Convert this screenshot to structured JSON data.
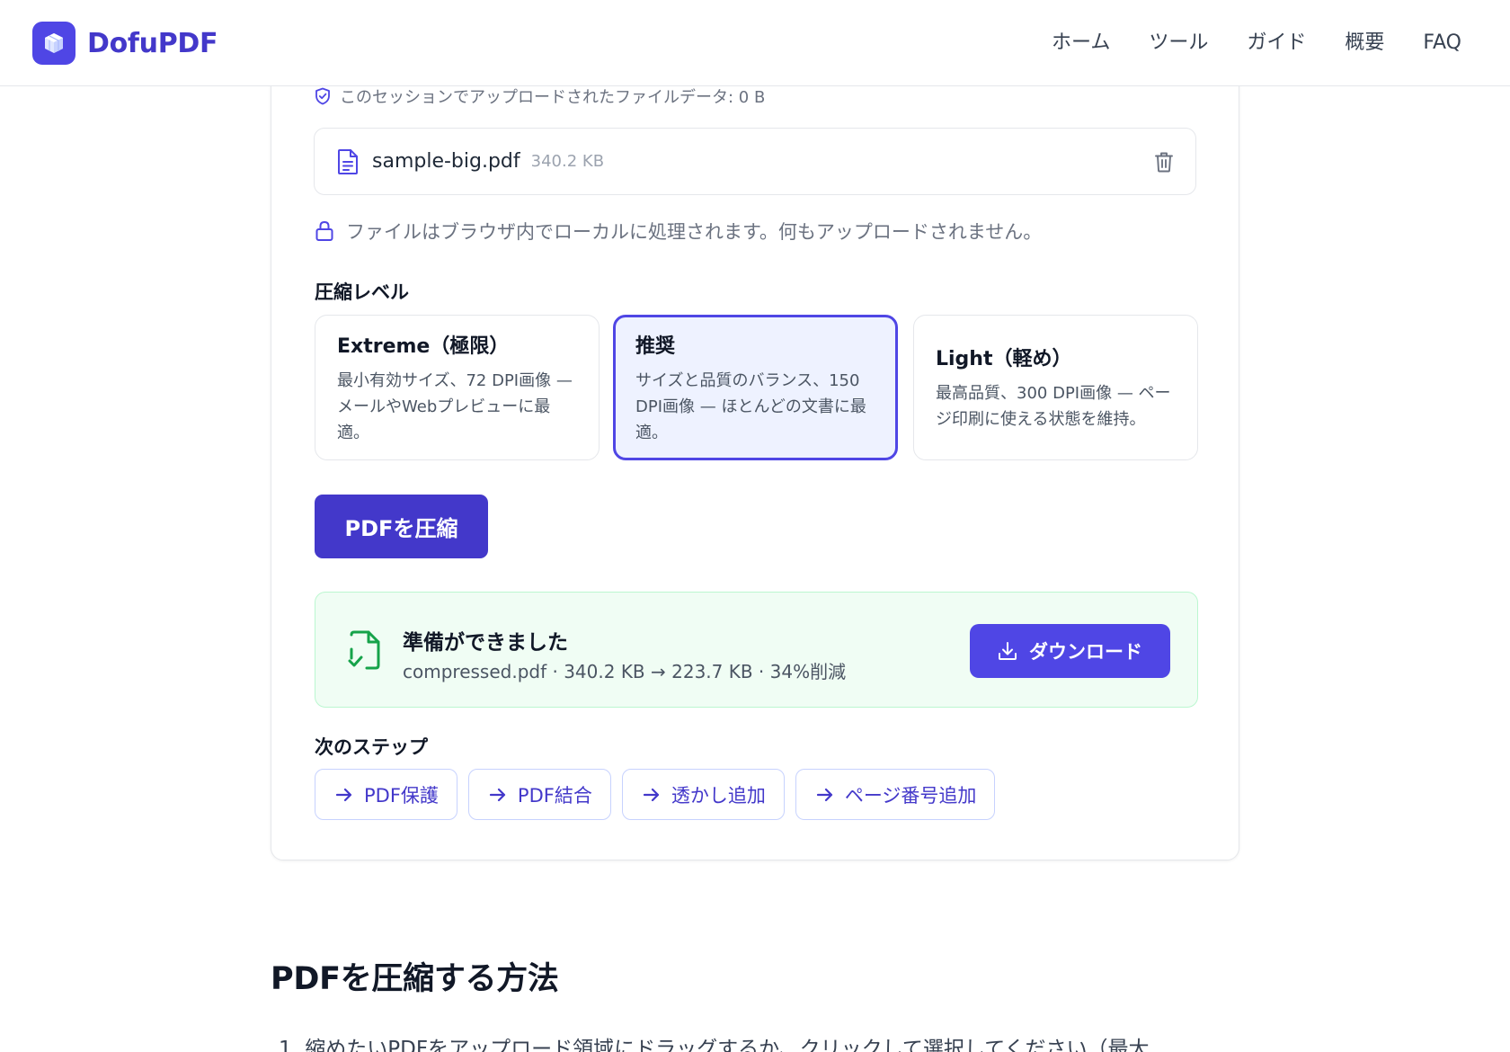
{
  "header": {
    "logo_text": "DofuPDF",
    "nav": [
      "ホーム",
      "ツール",
      "ガイド",
      "概要",
      "FAQ"
    ]
  },
  "session_text": "このセッションでアップロードされたファイルデータ: 0 B",
  "file": {
    "name": "sample-big.pdf",
    "size": "340.2 KB"
  },
  "local_notice": "ファイルはブラウザ内でローカルに処理されます。何もアップロードされません。",
  "compression": {
    "title": "圧縮レベル",
    "options": [
      {
        "title": "Extreme（極限）",
        "desc": "最小有効サイズ、72 DPI画像 — メールやWebプレビューに最適。",
        "selected": false
      },
      {
        "title": "推奨",
        "desc": "サイズと品質のバランス、150 DPI画像 — ほとんどの文書に最適。",
        "selected": true
      },
      {
        "title": "Light（軽め）",
        "desc": "最高品質、300 DPI画像 — ページ印刷に使える状態を維持。",
        "selected": false
      }
    ]
  },
  "compress_button": "PDFを圧縮",
  "result": {
    "title": "準備ができました",
    "desc": "compressed.pdf · 340.2 KB → 223.7 KB · 34%削減",
    "download": "ダウンロード"
  },
  "next_steps": {
    "title": "次のステップ",
    "items": [
      "PDF保護",
      "PDF結合",
      "透かし追加",
      "ページ番号追加"
    ]
  },
  "howto": {
    "title": "PDFを圧縮する方法",
    "step1": "1. 縮めたいPDFをアップロード領域にドラッグするか、クリックして選択してください（最大"
  },
  "colors": {
    "accent": "#4f46e5",
    "accent_dark": "#4338ca",
    "success_bg": "#f0fdf4",
    "success_icon": "#16a34a"
  },
  "icons": {
    "logo": "cube-icon",
    "session": "shield-check-icon",
    "file": "file-text-icon",
    "remove": "trash-icon",
    "local": "lock-icon",
    "result": "file-check-icon",
    "download": "download-icon",
    "step": "arrow-right-icon"
  }
}
